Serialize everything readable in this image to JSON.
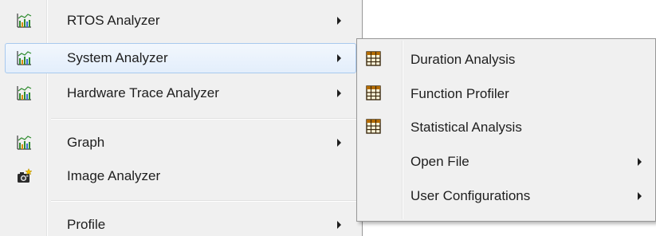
{
  "main_menu": {
    "items": [
      {
        "label": "RTOS Analyzer",
        "icon": "chart-icon",
        "has_submenu": true
      },
      {
        "label": "System Analyzer",
        "icon": "chart-icon",
        "has_submenu": true,
        "highlighted": true
      },
      {
        "label": "Hardware Trace Analyzer",
        "icon": "chart-icon",
        "has_submenu": true
      },
      {
        "label": "Graph",
        "icon": "chart-icon",
        "has_submenu": true
      },
      {
        "label": "Image Analyzer",
        "icon": "camera-icon",
        "has_submenu": false
      },
      {
        "label": "Profile",
        "icon": "",
        "has_submenu": true
      }
    ]
  },
  "sub_menu": {
    "items": [
      {
        "label": "Duration Analysis",
        "icon": "table-grid-icon",
        "has_submenu": false
      },
      {
        "label": "Function Profiler",
        "icon": "table-grid-icon",
        "has_submenu": false
      },
      {
        "label": "Statistical Analysis",
        "icon": "table-grid-icon",
        "has_submenu": false
      },
      {
        "label": "Open File",
        "icon": "",
        "has_submenu": true
      },
      {
        "label": "User Configurations",
        "icon": "",
        "has_submenu": true
      }
    ]
  },
  "colors": {
    "menu_bg": "#f0f0f0",
    "hover_border": "#a8c9ee",
    "table_icon": "#b36b00",
    "chart_green": "#2e8b2e"
  }
}
